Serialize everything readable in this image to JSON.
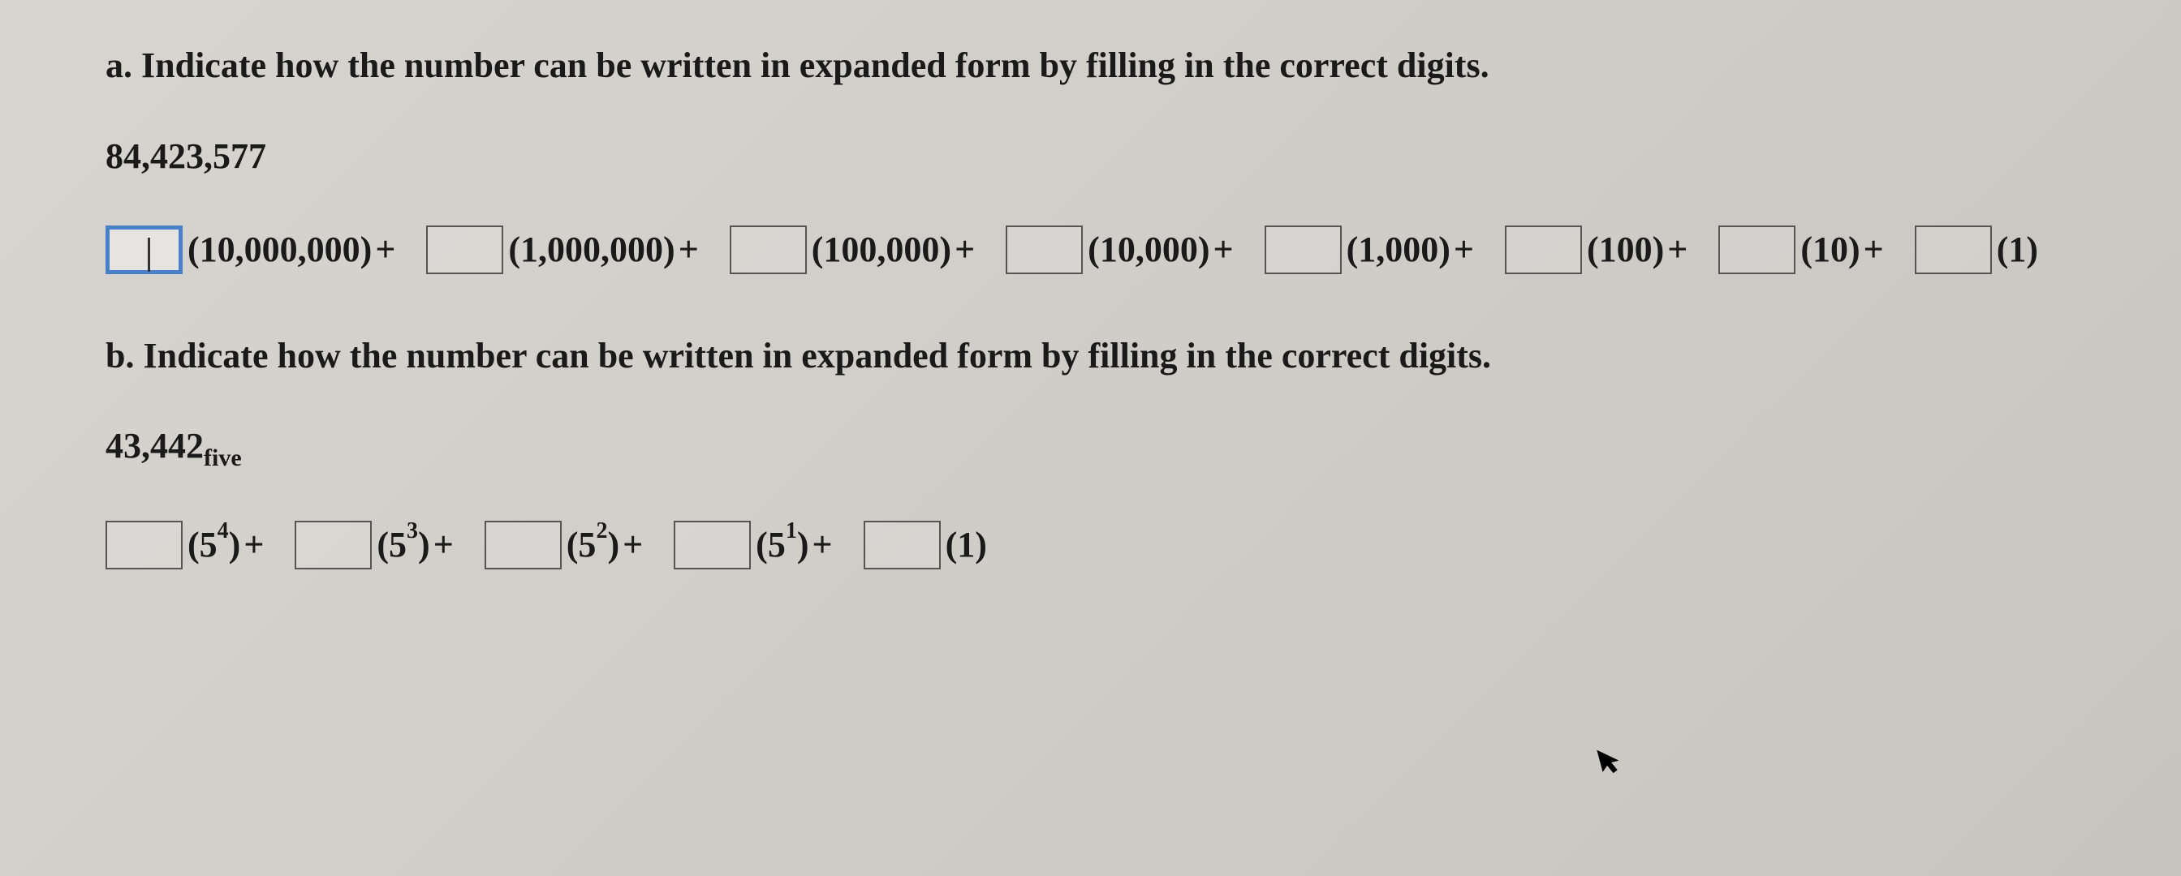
{
  "question_a": {
    "label": "a.",
    "prompt": "Indicate how the number can be written in expanded form by filling in the correct digits.",
    "number": "84,423,577",
    "terms": [
      {
        "value": "",
        "place": "(10,000,000)",
        "op": "+",
        "focused": true
      },
      {
        "value": "",
        "place": "(1,000,000)",
        "op": "+"
      },
      {
        "value": "",
        "place": "(100,000)",
        "op": "+"
      },
      {
        "value": "",
        "place": "(10,000)",
        "op": "+"
      },
      {
        "value": "",
        "place": "(1,000)",
        "op": "+"
      },
      {
        "value": "",
        "place": "(100)",
        "op": "+"
      },
      {
        "value": "",
        "place": "(10)",
        "op": "+"
      },
      {
        "value": "",
        "place": "(1)",
        "op": ""
      }
    ]
  },
  "question_b": {
    "label": "b.",
    "prompt": "Indicate how the number can be written in expanded form by filling in the correct digits.",
    "number_main": "43,442",
    "number_sub": "five",
    "terms": [
      {
        "value": "",
        "base": "(5",
        "exp": "4",
        "close": ")",
        "op": "+"
      },
      {
        "value": "",
        "base": "(5",
        "exp": "3",
        "close": ")",
        "op": "+"
      },
      {
        "value": "",
        "base": "(5",
        "exp": "2",
        "close": ")",
        "op": "+"
      },
      {
        "value": "",
        "base": "(5",
        "exp": "1",
        "close": ")",
        "op": "+"
      },
      {
        "value": "",
        "base": "(1)",
        "exp": "",
        "close": "",
        "op": ""
      }
    ]
  }
}
